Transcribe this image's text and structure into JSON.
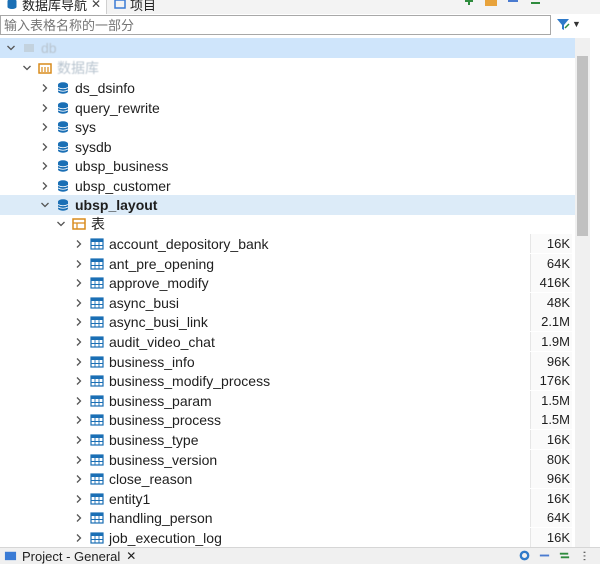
{
  "tabs": {
    "active_label": "数据库导航",
    "inactive_label": "项目"
  },
  "filter": {
    "placeholder": "输入表格名称的一部分"
  },
  "tree": {
    "connection_label": "db",
    "databases_label": "数据库",
    "databases": [
      "ds_dsinfo",
      "query_rewrite",
      "sys",
      "sysdb",
      "ubsp_business",
      "ubsp_customer",
      "ubsp_layout"
    ],
    "tables_folder_label": "表",
    "tables": [
      {
        "name": "account_depository_bank",
        "size": "16K"
      },
      {
        "name": "ant_pre_opening",
        "size": "64K"
      },
      {
        "name": "approve_modify",
        "size": "416K"
      },
      {
        "name": "async_busi",
        "size": "48K"
      },
      {
        "name": "async_busi_link",
        "size": "2.1M"
      },
      {
        "name": "audit_video_chat",
        "size": "1.9M"
      },
      {
        "name": "business_info",
        "size": "96K"
      },
      {
        "name": "business_modify_process",
        "size": "176K"
      },
      {
        "name": "business_param",
        "size": "1.5M"
      },
      {
        "name": "business_process",
        "size": "1.5M"
      },
      {
        "name": "business_type",
        "size": "16K"
      },
      {
        "name": "business_version",
        "size": "80K"
      },
      {
        "name": "close_reason",
        "size": "96K"
      },
      {
        "name": "entity1",
        "size": "16K"
      },
      {
        "name": "handling_person",
        "size": "64K"
      },
      {
        "name": "job_execution_log",
        "size": "16K"
      }
    ]
  },
  "bottom": {
    "project_label": "Project - General"
  },
  "colors": {
    "db_blue": "#1a6fb5",
    "folder_orange": "#d98b1c",
    "selection": "#dcebf8"
  },
  "icons": [
    "database-icon",
    "project-icon",
    "filter-icon",
    "table-icon",
    "folder-icon",
    "chevron-right-icon",
    "chevron-down-icon"
  ]
}
